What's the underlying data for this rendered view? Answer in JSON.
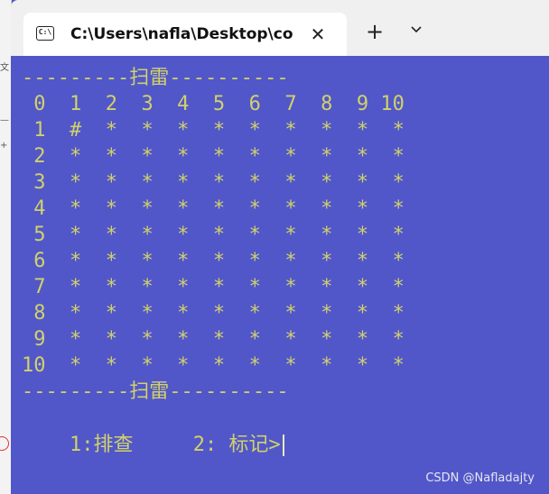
{
  "window": {
    "tab_title": "C:\\Users\\nafla\\Desktop\\college\\minesweeper.exe",
    "tab_icon_label": "C:\\",
    "close_glyph": "✕",
    "new_tab_glyph": "+"
  },
  "terminal": {
    "lines": [
      "---------扫雷----------",
      " 0  1  2  3  4  5  6  7  8  9 10",
      " 1  #  *  *  *  *  *  *  *  *  *",
      " 2  *  *  *  *  *  *  *  *  *  *",
      " 3  *  *  *  *  *  *  *  *  *  *",
      " 4  *  *  *  *  *  *  *  *  *  *",
      " 5  *  *  *  *  *  *  *  *  *  *",
      " 6  *  *  *  *  *  *  *  *  *  *",
      " 7  *  *  *  *  *  *  *  *  *  *",
      " 8  *  *  *  *  *  *  *  *  *  *",
      " 9  *  *  *  *  *  *  *  *  *  *",
      "10  *  *  *  *  *  *  *  *  *  *",
      "---------扫雷----------",
      "1:排查     2: 标记>"
    ],
    "text_color": "#d1d16a",
    "background_color": "#5157c9"
  },
  "watermark": "CSDN @Nafladajty"
}
